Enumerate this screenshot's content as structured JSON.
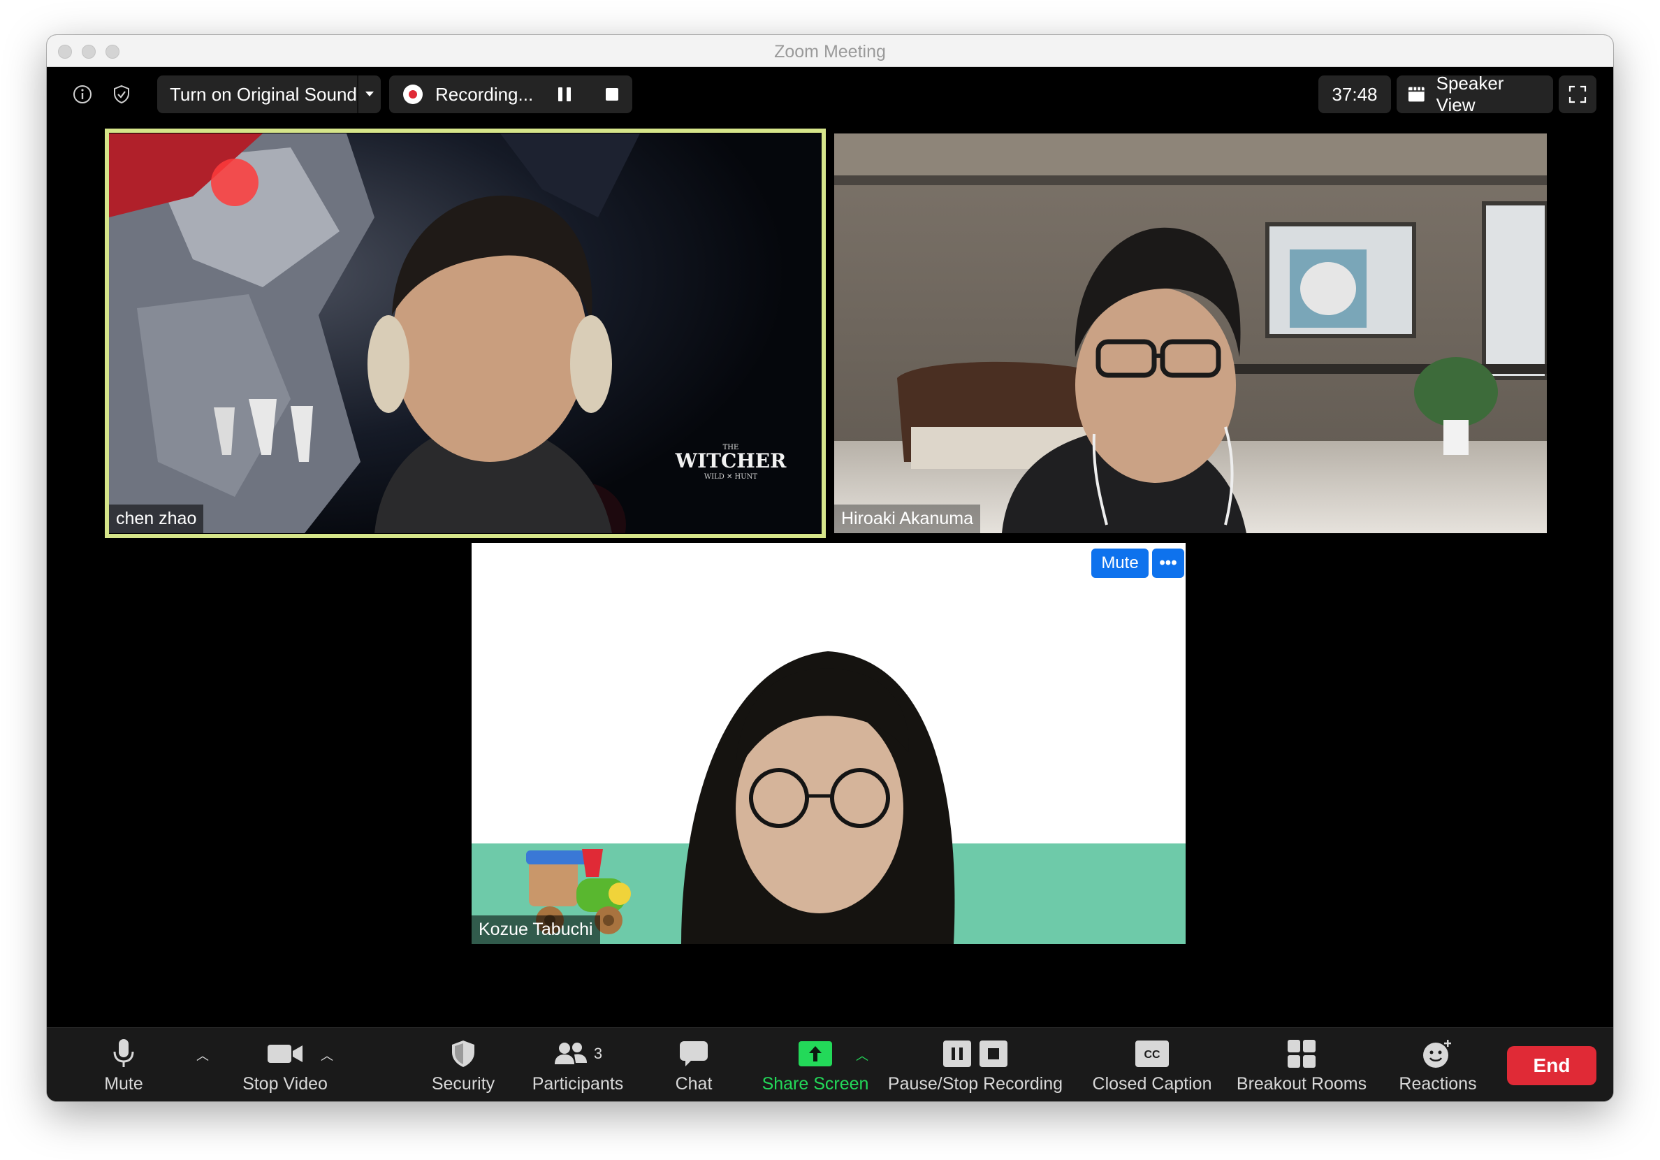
{
  "window": {
    "title": "Zoom Meeting"
  },
  "topbar": {
    "original_sound_label": "Turn on Original Sound",
    "recording_label": "Recording...",
    "timer": "37:48",
    "view_label": "Speaker View"
  },
  "participants_video": [
    {
      "name": "chen zhao",
      "active_speaker": true,
      "background_logo_text": "WITCHER"
    },
    {
      "name": "Hiroaki Akanuma",
      "active_speaker": false
    },
    {
      "name": "Kozue Tabuchi",
      "active_speaker": false,
      "hover_mute_label": "Mute",
      "hover_more_label": "•••"
    }
  ],
  "toolbar": {
    "mute_label": "Mute",
    "stop_video_label": "Stop Video",
    "security_label": "Security",
    "participants_label": "Participants",
    "participants_count": "3",
    "chat_label": "Chat",
    "share_screen_label": "Share Screen",
    "recording_control_label": "Pause/Stop Recording",
    "closed_caption_label": "Closed Caption",
    "closed_caption_badge": "CC",
    "breakout_rooms_label": "Breakout Rooms",
    "reactions_label": "Reactions",
    "end_label": "End"
  },
  "colors": {
    "active_speaker_border": "#d6e58a",
    "share_screen": "#23d959",
    "end_button": "#e02a36",
    "tile_button": "#0e72ed",
    "toolbar_bg": "#1a1a1a"
  }
}
